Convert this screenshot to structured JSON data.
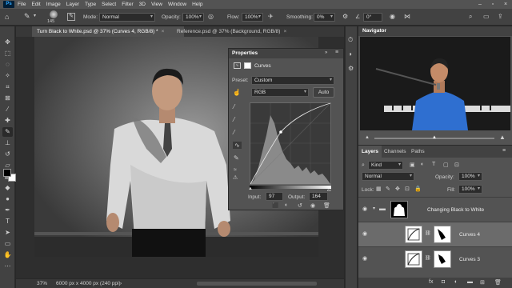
{
  "menu": {
    "logo": "Ps",
    "items": [
      "File",
      "Edit",
      "Image",
      "Layer",
      "Type",
      "Select",
      "Filter",
      "3D",
      "View",
      "Window",
      "Help"
    ]
  },
  "options": {
    "brush_size": "145",
    "mode_label": "Mode:",
    "mode_value": "Normal",
    "opacity_label": "Opacity:",
    "opacity_value": "100%",
    "flow_label": "Flow:",
    "flow_value": "100%",
    "smoothing_label": "Smoothing:",
    "smoothing_value": "0%",
    "angle_value": "0°"
  },
  "tabs": [
    {
      "label": "Turn Black to White.psd @ 37% (Curves 4, RGB/8) *",
      "close": "×"
    },
    {
      "label": "Reference.psd @ 37% (Background, RGB/8)",
      "close": "×"
    }
  ],
  "status": {
    "zoom": "37%",
    "doc_info": "6000 px x 4000 px (240 ppi)"
  },
  "properties": {
    "title": "Properties",
    "subtitle": "Curves",
    "preset_label": "Preset:",
    "preset_value": "Custom",
    "channel_value": "RGB",
    "auto_label": "Auto",
    "input_label": "Input:",
    "input_value": "97",
    "output_label": "Output:",
    "output_value": "164"
  },
  "navigator": {
    "title": "Navigator"
  },
  "layers_panel": {
    "tabs": [
      "Layers",
      "Channels",
      "Paths"
    ],
    "filter_value": "Kind",
    "blend_value": "Normal",
    "opacity_label": "Opacity:",
    "opacity_value": "100%",
    "lock_label": "Lock:",
    "fill_label": "Fill:",
    "fill_value": "100%",
    "layers": [
      {
        "name": "Changing Black to White",
        "selected": false
      },
      {
        "name": "Curves 4",
        "selected": true
      },
      {
        "name": "Curves 3",
        "selected": false
      }
    ]
  },
  "colors": {
    "accent": "#31a8ff",
    "panel": "#535353",
    "dark": "#282828"
  }
}
